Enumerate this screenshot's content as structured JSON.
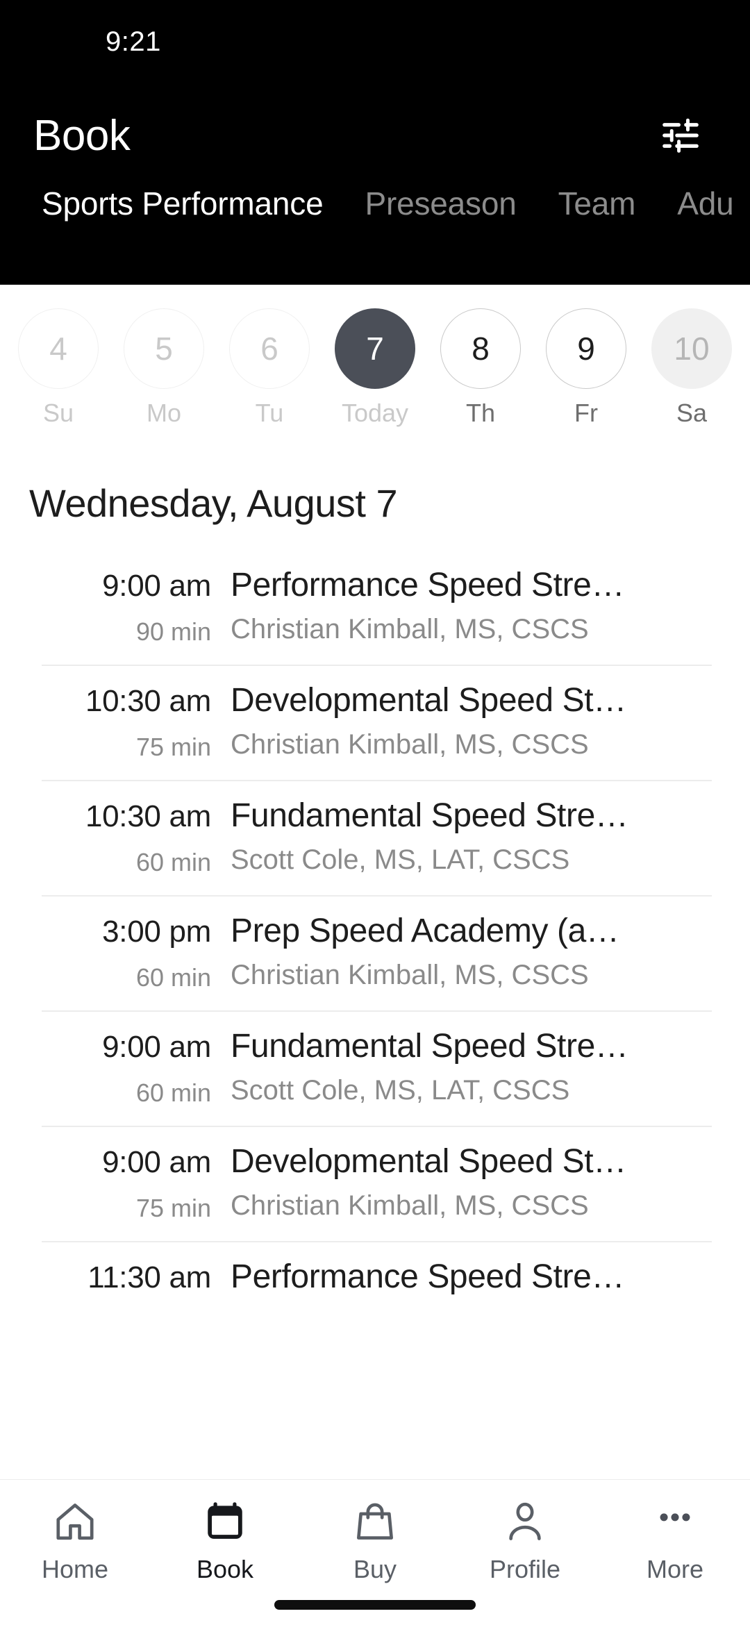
{
  "status_bar": {
    "time": "9:21"
  },
  "header": {
    "title": "Book",
    "filter_icon": "tune-sliders-icon",
    "accent_dark": "#000000",
    "active_tab_color": "#ffffff",
    "inactive_tab_color": "#8c8c8c",
    "tabs": [
      {
        "label": "Sports Performance",
        "active": true
      },
      {
        "label": "Preseason",
        "active": false
      },
      {
        "label": "Team",
        "active": false
      },
      {
        "label": "Adu",
        "active": false
      }
    ]
  },
  "date_strip": {
    "selected_day": "7",
    "days": [
      {
        "num": "4",
        "weekday": "Su",
        "state": "past"
      },
      {
        "num": "5",
        "weekday": "Mo",
        "state": "past"
      },
      {
        "num": "6",
        "weekday": "Tu",
        "state": "past"
      },
      {
        "num": "7",
        "weekday": "Today",
        "state": "today"
      },
      {
        "num": "8",
        "weekday": "Th",
        "state": "future"
      },
      {
        "num": "9",
        "weekday": "Fr",
        "state": "future"
      },
      {
        "num": "10",
        "weekday": "Sa",
        "state": "edge"
      }
    ],
    "selected_color": "#4b4f58"
  },
  "day_heading": "Wednesday, August 7",
  "classes": [
    {
      "time": "9:00 am",
      "duration": "90 min",
      "name": "Performance Speed Stre…",
      "coach": "Christian Kimball, MS, CSCS"
    },
    {
      "time": "10:30 am",
      "duration": "75 min",
      "name": "Developmental Speed St…",
      "coach": "Christian Kimball, MS, CSCS"
    },
    {
      "time": "10:30 am",
      "duration": "60 min",
      "name": "Fundamental Speed Stre…",
      "coach": "Scott Cole, MS, LAT, CSCS"
    },
    {
      "time": "3:00 pm",
      "duration": "60 min",
      "name": "Prep Speed Academy (a…",
      "coach": "Christian Kimball, MS, CSCS"
    },
    {
      "time": "9:00 am",
      "duration": "60 min",
      "name": "Fundamental Speed Stre…",
      "coach": "Scott Cole, MS, LAT, CSCS"
    },
    {
      "time": "9:00 am",
      "duration": "75 min",
      "name": "Developmental Speed St…",
      "coach": "Christian Kimball, MS, CSCS"
    },
    {
      "time": "11:30 am",
      "duration": "",
      "name": "Performance Speed Stre…",
      "coach": ""
    }
  ],
  "bottom_nav": {
    "items": [
      {
        "label": "Home",
        "icon": "home-icon",
        "active": false
      },
      {
        "label": "Book",
        "icon": "calendar-icon",
        "active": true
      },
      {
        "label": "Buy",
        "icon": "shopping-bag-icon",
        "active": false
      },
      {
        "label": "Profile",
        "icon": "person-icon",
        "active": false
      },
      {
        "label": "More",
        "icon": "ellipsis-icon",
        "active": false
      }
    ]
  }
}
